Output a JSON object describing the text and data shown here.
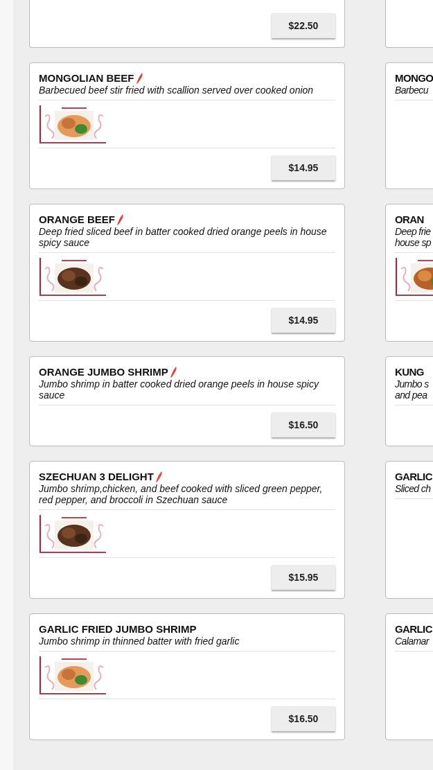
{
  "menu_items": [
    {
      "cut_off": true,
      "price": "$22.50"
    },
    {
      "cut_off": true
    },
    {
      "name": "MONGOLIAN BEEF",
      "spicy": true,
      "description": "Barbecued beef stir fried with scallion served over cooked onion",
      "photo": true,
      "price": "$14.95"
    },
    {
      "name": "MONGO",
      "description": "Barbecu"
    },
    {
      "name": "ORANGE BEEF",
      "spicy": true,
      "description": "Deep fried sliced beef in batter cooked dried orange peels in house spicy sauce",
      "photo": true,
      "price": "$14.95"
    },
    {
      "name": "ORAN",
      "description": "Deep frie\nhouse sp",
      "photo": true
    },
    {
      "name": "ORANGE JUMBO SHRIMP",
      "spicy": true,
      "description": "Jumbo shrimp in batter cooked dried orange peels in house spicy sauce",
      "price": "$16.50"
    },
    {
      "name": "KUNG",
      "description": "Jumbo s\nand pea"
    },
    {
      "name": "SZECHUAN 3 DELIGHT",
      "spicy": true,
      "description": "Jumbo shrimp,chicken, and beef cooked with sliced green pepper, red pepper, and broccoli in Szechuan sauce",
      "photo": true,
      "price": "$15.95"
    },
    {
      "name": "GARLIC",
      "description": "Sliced ch"
    },
    {
      "name": "GARLIC FRIED JUMBO SHRIMP",
      "description": "Jumbo shrimp in thinned batter with fried garlic",
      "photo": true,
      "price": "$16.50"
    },
    {
      "name": "GARLIC",
      "description": "Calamar"
    }
  ]
}
